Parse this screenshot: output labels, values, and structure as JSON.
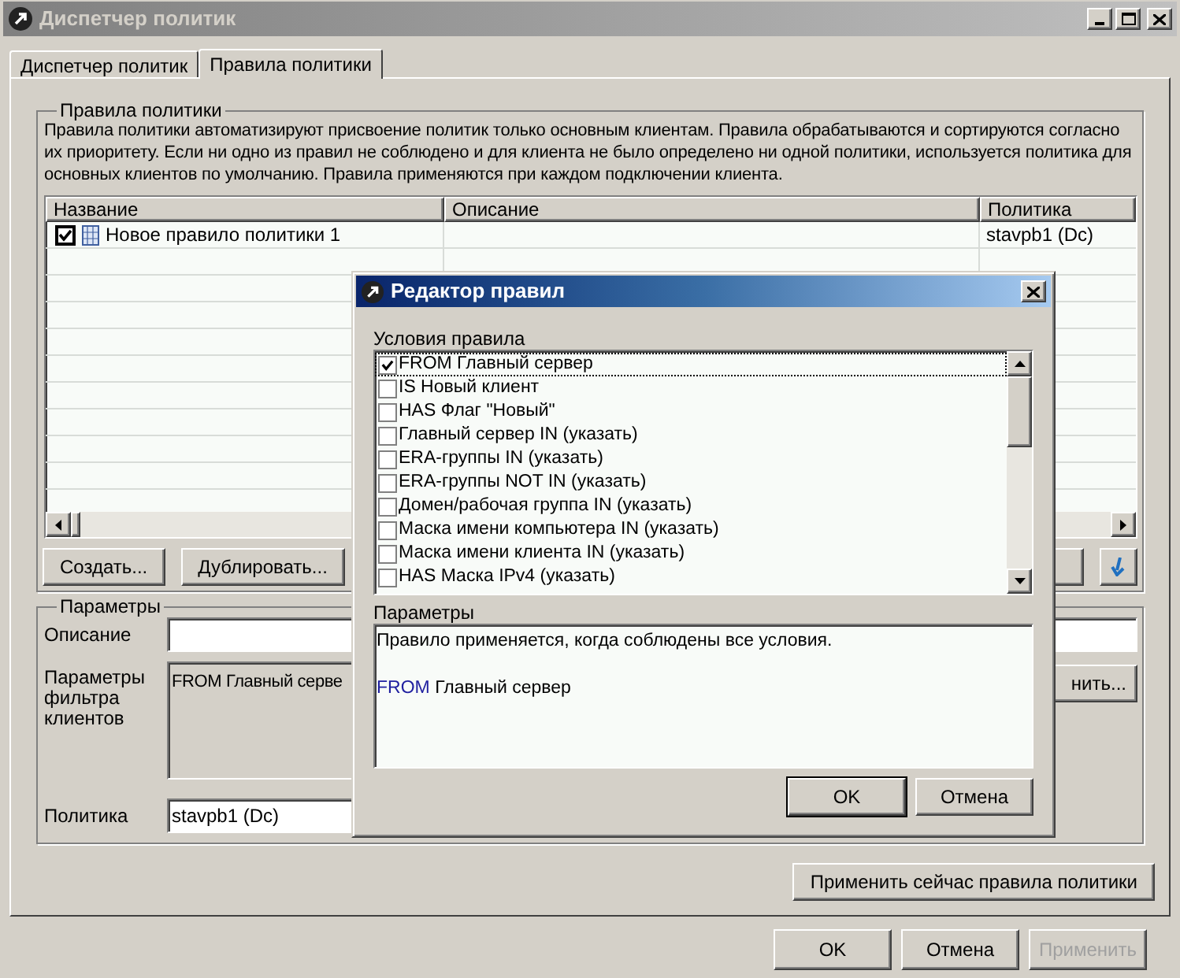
{
  "window": {
    "title": "Диспетчер политик"
  },
  "tabs": [
    {
      "label": "Диспетчер политик",
      "selected": false
    },
    {
      "label": "Правила политики",
      "selected": true
    }
  ],
  "rules_group": {
    "title": "Правила политики",
    "description": "Правила политики автоматизируют присвоение политик только основным клиентам. Правила обрабатываются и сортируются согласно их приоритету. Если ни одно из правил не соблюдено и для клиента не было определено ни одной политики, используется политика для основных клиентов по умолчанию. Правила применяются при каждом подключении клиента.",
    "table": {
      "columns": [
        "Название",
        "Описание",
        "Политика"
      ],
      "rows": [
        {
          "checked": true,
          "name": "Новое правило политики 1",
          "policy": "stavpb1 (Dc)"
        }
      ]
    },
    "buttons": [
      "Создать...",
      "Дублировать..."
    ]
  },
  "parameters_group": {
    "title": "Параметры",
    "description_label": "Описание",
    "filter_label": "Параметры фильтра клиентов",
    "filter_value": "FROM Главный серве",
    "edit_button": "нить...",
    "policy_label": "Политика",
    "policy_value": "stavpb1 (Dc)"
  },
  "apply_now_button": "Применить сейчас правила политики",
  "footer_buttons": [
    {
      "label": "OK",
      "disabled": false
    },
    {
      "label": "Отмена",
      "disabled": false
    },
    {
      "label": "Применить",
      "disabled": true
    }
  ],
  "rule_editor": {
    "title": "Редактор правил",
    "conditions_label": "Условия правила",
    "conditions": [
      {
        "label": "FROM Главный сервер",
        "checked": true,
        "selected": true
      },
      {
        "label": "IS Новый клиент",
        "checked": false,
        "selected": false
      },
      {
        "label": "HAS Флаг \"Новый\"",
        "checked": false,
        "selected": false
      },
      {
        "label": "Главный сервер IN (указать)",
        "checked": false,
        "selected": false
      },
      {
        "label": "ERA-группы IN (указать)",
        "checked": false,
        "selected": false
      },
      {
        "label": "ERA-группы NOT IN (указать)",
        "checked": false,
        "selected": false
      },
      {
        "label": "Домен/рабочая группа IN (указать)",
        "checked": false,
        "selected": false
      },
      {
        "label": "Маска имени компьютера IN (указать)",
        "checked": false,
        "selected": false
      },
      {
        "label": "Маска имени клиента IN (указать)",
        "checked": false,
        "selected": false
      },
      {
        "label": "HAS Маска IPv4 (указать)",
        "checked": false,
        "selected": false
      }
    ],
    "params_label": "Параметры",
    "params_text": "Правило применяется, когда соблюдены все условия.",
    "params_keyword": "FROM",
    "params_value": "Главный сервер",
    "buttons": [
      {
        "label": "OK",
        "default": true
      },
      {
        "label": "Отмена",
        "default": false
      }
    ]
  }
}
